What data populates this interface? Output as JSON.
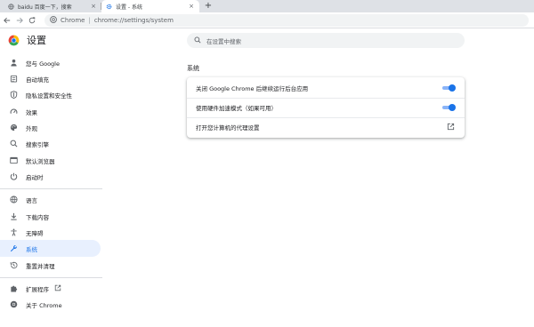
{
  "tabs": [
    {
      "label": "baidu 百度一下，搜索",
      "icon": "globe-icon"
    },
    {
      "label": "设置 - 系统",
      "icon": "gear-icon"
    }
  ],
  "toolbar": {
    "omnibox_scheme": "Chrome",
    "omnibox_separator": "|",
    "omnibox_url": "chrome://settings/system"
  },
  "header": {
    "title": "设置",
    "search_placeholder": "在设置中搜索"
  },
  "sidebar": {
    "items": [
      {
        "label": "您与 Google",
        "icon": "person-icon"
      },
      {
        "label": "自动填充",
        "icon": "clipboard-icon"
      },
      {
        "label": "隐私设置和安全性",
        "icon": "shield-icon"
      },
      {
        "label": "效果",
        "icon": "speedometer-icon"
      },
      {
        "label": "外观",
        "icon": "palette-icon"
      },
      {
        "label": "搜索引擎",
        "icon": "search-icon"
      },
      {
        "label": "默认浏览器",
        "icon": "browser-icon"
      },
      {
        "label": "启动时",
        "icon": "power-icon"
      },
      {
        "label": "语言",
        "icon": "globe-icon"
      },
      {
        "label": "下载内容",
        "icon": "download-icon"
      },
      {
        "label": "无障碍",
        "icon": "accessibility-icon"
      },
      {
        "label": "系统",
        "icon": "wrench-icon",
        "active": true
      },
      {
        "label": "重置并清理",
        "icon": "history-icon"
      },
      {
        "label": "扩展程序",
        "icon": "puzzle-icon"
      },
      {
        "label": "关于 Chrome",
        "icon": "chrome-icon"
      }
    ]
  },
  "main": {
    "section_title": "系统",
    "rows": [
      {
        "label": "关闭 Google Chrome 后继续运行后台应用",
        "control": "toggle",
        "on": true
      },
      {
        "label": "使用硬件加速模式（如果可用）",
        "control": "toggle",
        "on": true
      },
      {
        "label": "打开您计算机的代理设置",
        "control": "external-link"
      }
    ]
  },
  "colors": {
    "accent": "#1a73e8",
    "active_bg": "#e8f0fe",
    "tabstrip": "#dee1e6"
  }
}
